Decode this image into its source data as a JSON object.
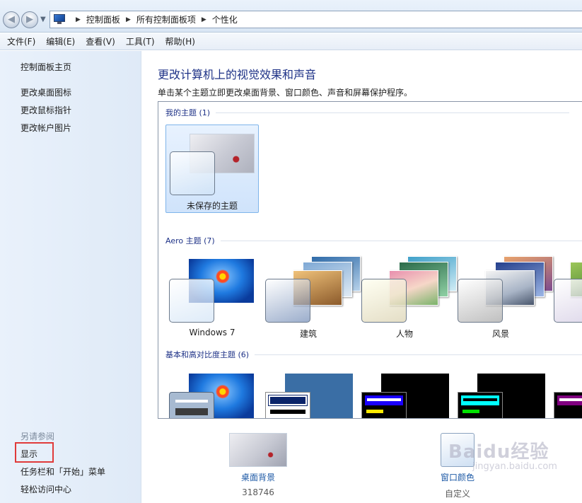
{
  "address": {
    "crumbs": [
      "控制面板",
      "所有控制面板项",
      "个性化"
    ]
  },
  "menu": [
    "文件(F)",
    "编辑(E)",
    "查看(V)",
    "工具(T)",
    "帮助(H)"
  ],
  "sidebar": {
    "home": "控制面板主页",
    "links": [
      "更改桌面图标",
      "更改鼠标指针",
      "更改帐户图片"
    ],
    "see_also_title": "另请参阅",
    "see_also": [
      "显示",
      "任务栏和「开始」菜单",
      "轻松访问中心"
    ]
  },
  "main": {
    "title": "更改计算机上的视觉效果和声音",
    "subtitle": "单击某个主题立即更改桌面背景、窗口颜色、声音和屏幕保护程序。",
    "groups": {
      "my": "我的主题 (1)",
      "aero": "Aero 主题 (7)",
      "basic": "基本和高对比度主题 (6)"
    },
    "my_theme": "未保存的主题",
    "aero_themes": [
      "Windows 7",
      "建筑",
      "人物",
      "风景"
    ]
  },
  "settings": {
    "background_label": "桌面背景",
    "background_value": "318746",
    "color_label": "窗口颜色",
    "color_value": "自定义"
  },
  "watermark": {
    "brand": "Baidu经验",
    "url": "jingyan.baidu.com"
  }
}
